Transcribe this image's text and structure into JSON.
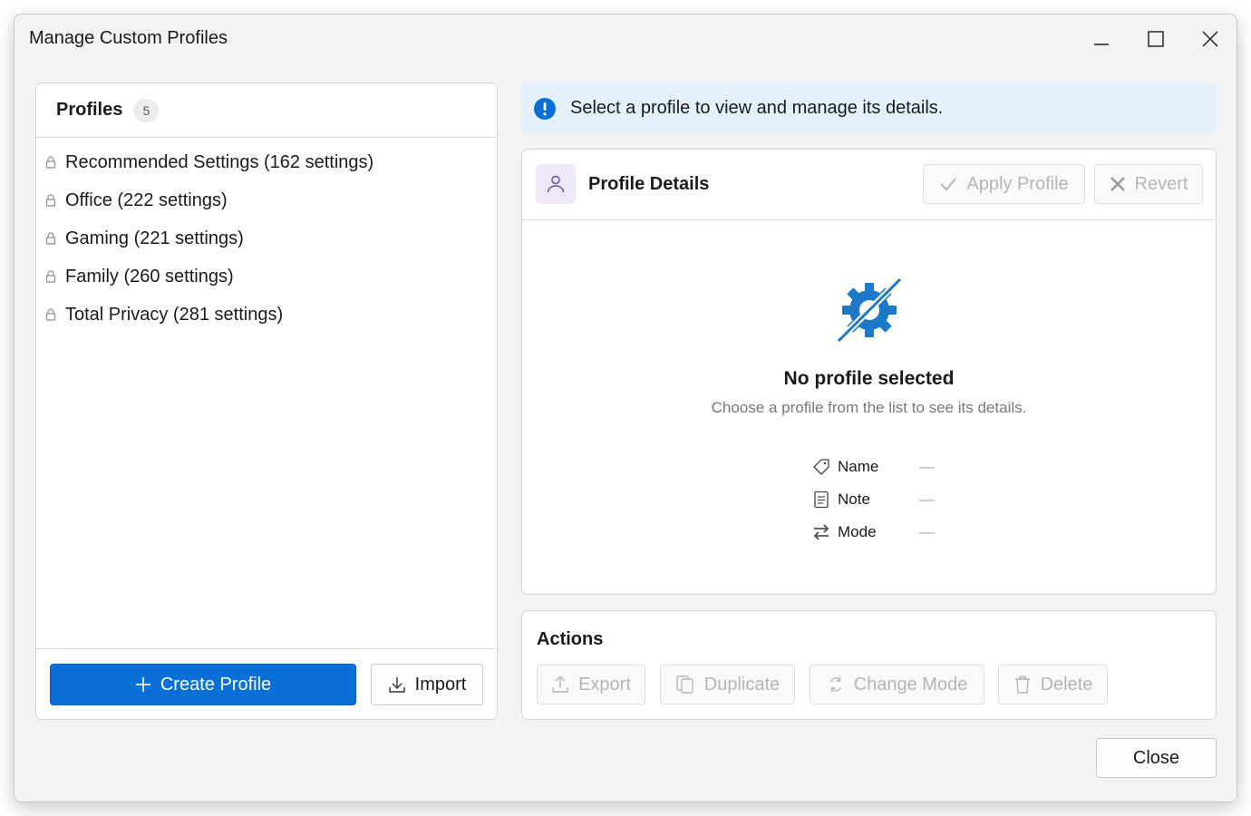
{
  "window": {
    "title": "Manage Custom Profiles"
  },
  "profiles": {
    "header": "Profiles",
    "count": "5",
    "items": [
      {
        "label": "Recommended Settings (162 settings)"
      },
      {
        "label": "Office (222 settings)"
      },
      {
        "label": "Gaming (221 settings)"
      },
      {
        "label": "Family (260 settings)"
      },
      {
        "label": "Total Privacy (281 settings)"
      }
    ],
    "create_label": "Create Profile",
    "import_label": "Import"
  },
  "info": {
    "message": "Select a profile to view and manage its details."
  },
  "details": {
    "title": "Profile Details",
    "apply_label": "Apply Profile",
    "revert_label": "Revert",
    "empty_title": "No profile selected",
    "empty_subtitle": "Choose a profile from the list to see its details.",
    "fields": [
      {
        "label": "Name",
        "value": "—",
        "icon": "tag-icon"
      },
      {
        "label": "Note",
        "value": "—",
        "icon": "note-icon"
      },
      {
        "label": "Mode",
        "value": "—",
        "icon": "swap-icon"
      }
    ]
  },
  "actions": {
    "title": "Actions",
    "export_label": "Export",
    "duplicate_label": "Duplicate",
    "change_mode_label": "Change Mode",
    "delete_label": "Delete"
  },
  "footer": {
    "close_label": "Close"
  },
  "colors": {
    "accent": "#0a6fd6",
    "info_bg": "#e6f0fb",
    "gear_icon": "#1e78c8",
    "disabled_text": "#b5b5b5"
  }
}
